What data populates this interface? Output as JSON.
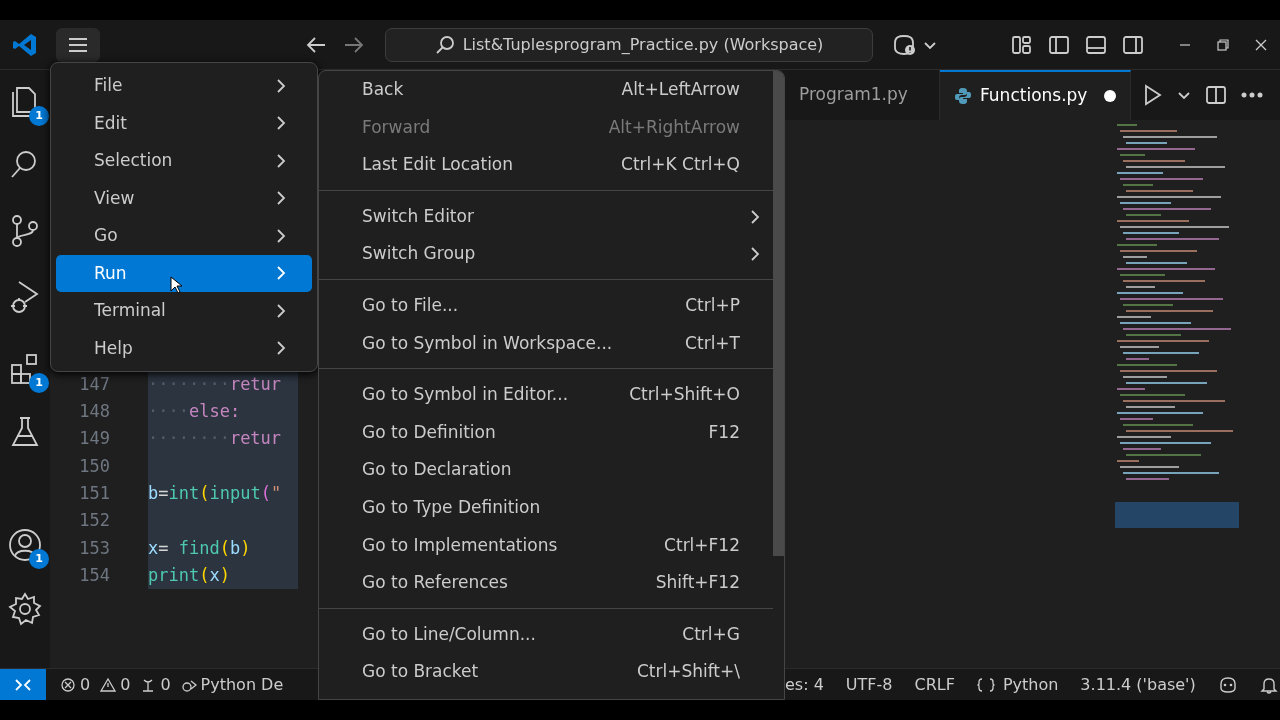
{
  "title_bar": {
    "search": "List&Tuplesprogram_Practice.py (Workspace)"
  },
  "activity_bar": [
    {
      "kind": "files",
      "badge": "1"
    },
    {
      "kind": "search"
    },
    {
      "kind": "branch"
    },
    {
      "kind": "debug"
    },
    {
      "kind": "extensions",
      "badge": "1"
    },
    {
      "kind": "testing"
    },
    {
      "kind": "account",
      "badge": "1"
    },
    {
      "kind": "settings"
    }
  ],
  "tabs": [
    {
      "label": "Program1.py",
      "selected": false,
      "modified": false
    },
    {
      "label": "Functions.py",
      "selected": true,
      "modified": true
    }
  ],
  "editor": {
    "lines": [
      {
        "number": "147",
        "tokens": [
          {
            "t": "········",
            "kind": "whitespace"
          },
          {
            "t": "retur",
            "kind": "keyword"
          }
        ]
      },
      {
        "number": "148",
        "tokens": [
          {
            "t": "····",
            "kind": "whitespace"
          },
          {
            "t": "else:",
            "kind": "keyword"
          }
        ]
      },
      {
        "number": "149",
        "tokens": [
          {
            "t": "········",
            "kind": "whitespace"
          },
          {
            "t": "retur",
            "kind": "keyword"
          }
        ]
      },
      {
        "number": "150"
      },
      {
        "number": "151",
        "tokens": [
          {
            "t": "b",
            "kind": "variable"
          },
          {
            "t": "=",
            "kind": "operator"
          },
          {
            "t": "int",
            "kind": "function"
          },
          {
            "t": "(",
            "kind": "bracket"
          },
          {
            "t": "input",
            "kind": "function"
          },
          {
            "t": "(",
            "kind": "bracket2"
          },
          {
            "t": "\"",
            "kind": "string"
          }
        ]
      },
      {
        "number": "152"
      },
      {
        "number": "153",
        "tokens": [
          {
            "t": "x",
            "kind": "variable"
          },
          {
            "t": "= ",
            "kind": "operator"
          },
          {
            "t": "find",
            "kind": "function"
          },
          {
            "t": "(",
            "kind": "bracket"
          },
          {
            "t": "b",
            "kind": "variable"
          },
          {
            "t": ")",
            "kind": "bracket"
          }
        ]
      },
      {
        "number": "154",
        "tokens": [
          {
            "t": "print",
            "kind": "function"
          },
          {
            "t": "(",
            "kind": "bracket"
          },
          {
            "t": "x",
            "kind": "variable"
          },
          {
            "t": ")",
            "kind": "bracket"
          }
        ]
      }
    ]
  },
  "main_menu": [
    {
      "label": "File",
      "selected": false
    },
    {
      "label": "Edit",
      "selected": false
    },
    {
      "label": "Selection",
      "selected": false
    },
    {
      "label": "View",
      "selected": false
    },
    {
      "label": "Go",
      "selected": false
    },
    {
      "label": "Run",
      "selected": true
    },
    {
      "label": "Terminal",
      "selected": false
    },
    {
      "label": "Help",
      "selected": false
    }
  ],
  "go_menu": [
    [
      {
        "label": "Back",
        "shortcut": "Alt+LeftArrow",
        "kind": "command",
        "disabled": false
      },
      {
        "label": "Forward",
        "shortcut": "Alt+RightArrow",
        "kind": "command",
        "disabled": true
      },
      {
        "label": "Last Edit Location",
        "shortcut": "Ctrl+K Ctrl+Q",
        "kind": "command",
        "disabled": false
      }
    ],
    [
      {
        "label": "Switch Editor",
        "kind": "submenu",
        "disabled": false
      },
      {
        "label": "Switch Group",
        "kind": "submenu",
        "disabled": false
      }
    ],
    [
      {
        "label": "Go to File...",
        "shortcut": "Ctrl+P",
        "kind": "command",
        "disabled": false
      },
      {
        "label": "Go to Symbol in Workspace...",
        "shortcut": "Ctrl+T",
        "kind": "command",
        "disabled": false
      }
    ],
    [
      {
        "label": "Go to Symbol in Editor...",
        "shortcut": "Ctrl+Shift+O",
        "kind": "command",
        "disabled": false
      },
      {
        "label": "Go to Definition",
        "shortcut": "F12",
        "kind": "command",
        "disabled": false
      },
      {
        "label": "Go to Declaration",
        "kind": "command",
        "disabled": false
      },
      {
        "label": "Go to Type Definition",
        "kind": "command",
        "disabled": false
      },
      {
        "label": "Go to Implementations",
        "shortcut": "Ctrl+F12",
        "kind": "command",
        "disabled": false
      },
      {
        "label": "Go to References",
        "shortcut": "Shift+F12",
        "kind": "command",
        "disabled": false
      }
    ],
    [
      {
        "label": "Go to Line/Column...",
        "shortcut": "Ctrl+G",
        "kind": "command",
        "disabled": false
      },
      {
        "label": "Go to Bracket",
        "shortcut": "Ctrl+Shift+\\",
        "kind": "command",
        "disabled": false
      }
    ]
  ],
  "status_bar": {
    "left": [
      {
        "kind": "errors",
        "text": "0"
      },
      {
        "kind": "warnings",
        "text": "0"
      },
      {
        "kind": "ports",
        "text": "0"
      },
      {
        "kind": "debug",
        "text": "Python De"
      }
    ],
    "right": [
      {
        "kind": "text",
        "text": "es: 4"
      },
      {
        "kind": "text",
        "text": "UTF-8"
      },
      {
        "kind": "text",
        "text": "CRLF"
      },
      {
        "kind": "language",
        "text": "Python"
      },
      {
        "kind": "text",
        "text": "3.11.4 ('base')"
      }
    ]
  }
}
